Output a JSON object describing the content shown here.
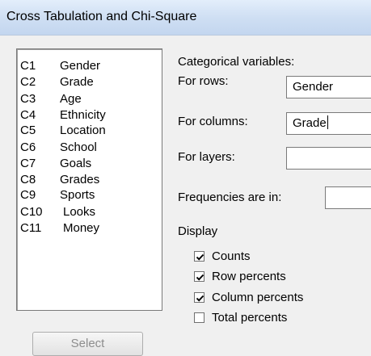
{
  "window": {
    "title": "Cross Tabulation and Chi-Square"
  },
  "variables": [
    {
      "col": "C1",
      "name": "Gender"
    },
    {
      "col": "C2",
      "name": "Grade"
    },
    {
      "col": "C3",
      "name": "Age"
    },
    {
      "col": "C4",
      "name": "Ethnicity"
    },
    {
      "col": "C5",
      "name": "Location"
    },
    {
      "col": "C6",
      "name": "School"
    },
    {
      "col": "C7",
      "name": "Goals"
    },
    {
      "col": "C8",
      "name": "Grades"
    },
    {
      "col": "C9",
      "name": "Sports"
    },
    {
      "col": "C10",
      "name": "Looks"
    },
    {
      "col": "C11",
      "name": "Money"
    }
  ],
  "form": {
    "categorical_label": "Categorical variables:",
    "rows_label": "For rows:",
    "rows_value": "Gender",
    "columns_label": "For columns:",
    "columns_value": "Grade",
    "layers_label": "For layers:",
    "layers_value": "",
    "frequencies_label": "Frequencies are in:",
    "frequencies_value": ""
  },
  "display": {
    "label": "Display",
    "options": [
      {
        "label": "Counts",
        "checked": true
      },
      {
        "label": "Row percents",
        "checked": true
      },
      {
        "label": "Column percents",
        "checked": true
      },
      {
        "label": "Total percents",
        "checked": false
      }
    ]
  },
  "buttons": {
    "select_label": "Select"
  }
}
